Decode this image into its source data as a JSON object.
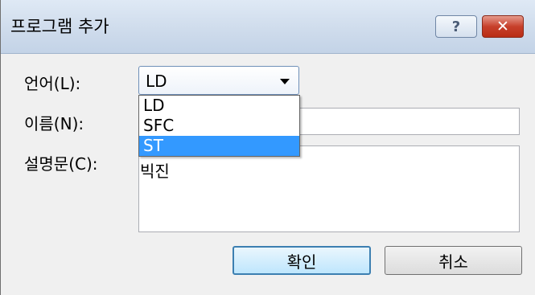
{
  "dialog": {
    "title": "프로그램 추가",
    "help_label": "?",
    "close_label": "✕"
  },
  "form": {
    "language_label": "언어(L):",
    "language_value": "LD",
    "name_label": "이름(N):",
    "name_value": "",
    "description_label": "설명문(C):",
    "description_value": "빅진"
  },
  "dropdown": {
    "options": [
      "LD",
      "SFC",
      "ST"
    ],
    "highlighted": "ST"
  },
  "buttons": {
    "ok_label": "확인",
    "cancel_label": "취소"
  },
  "colors": {
    "highlight": "#3399ff",
    "close": "#c7402b"
  }
}
